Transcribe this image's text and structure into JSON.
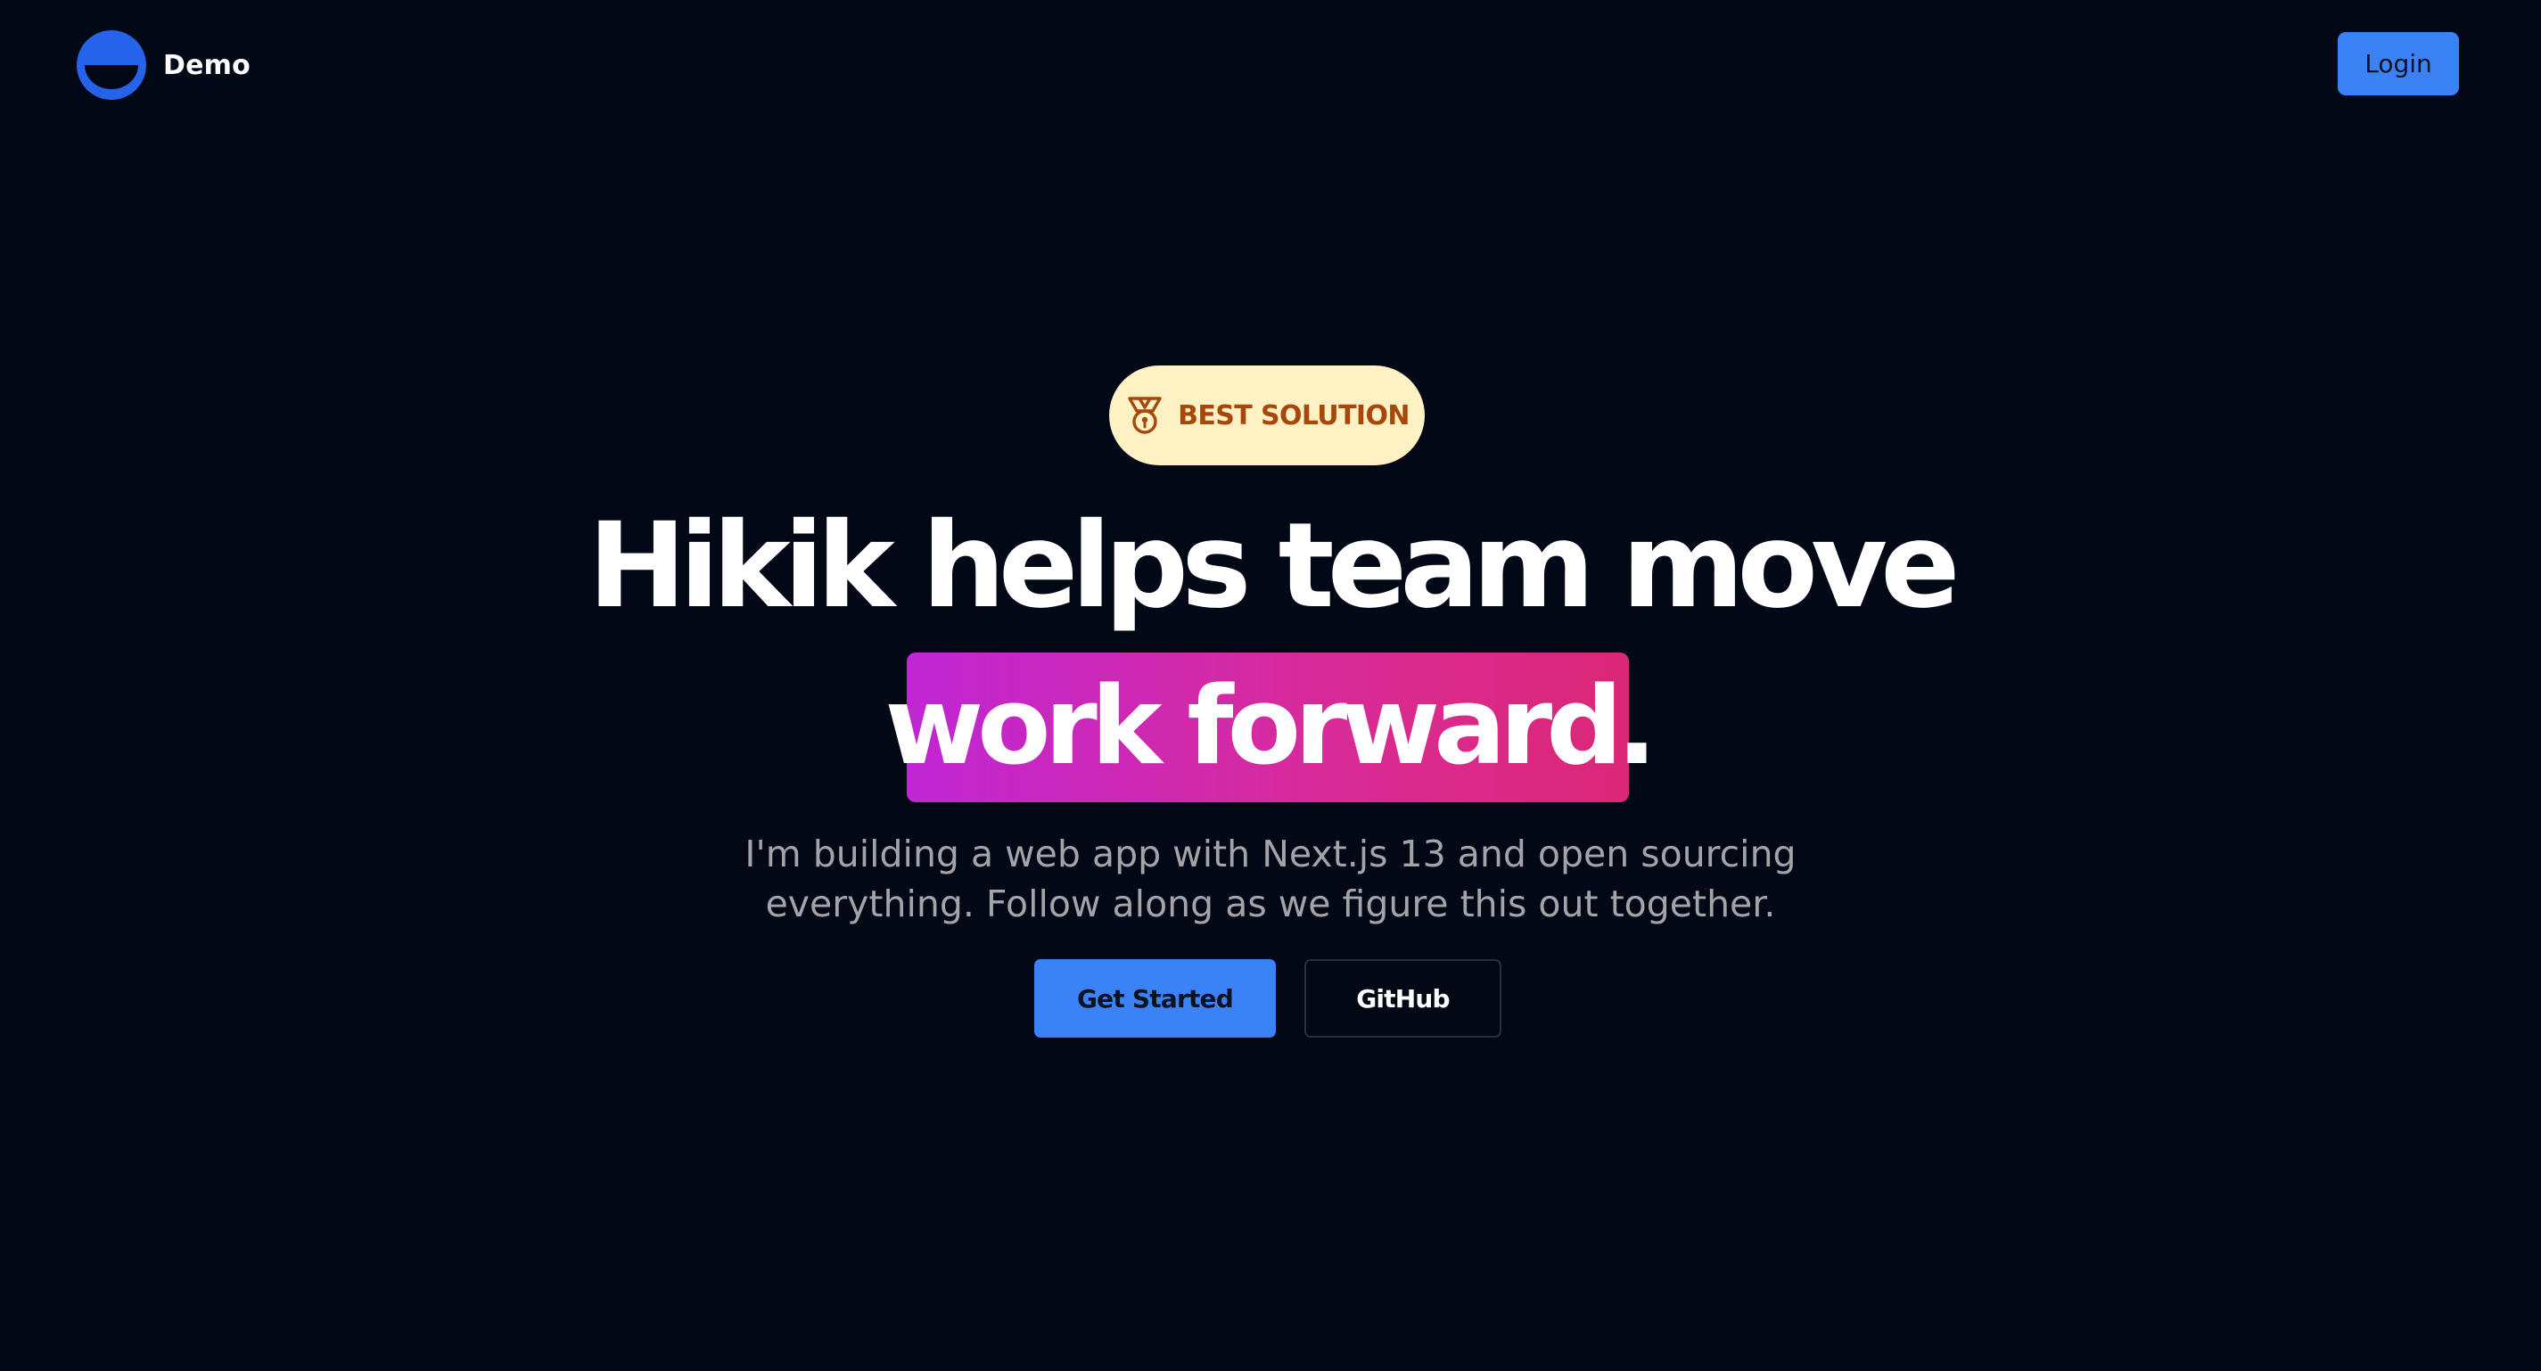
{
  "header": {
    "brand_name": "Demo",
    "logo_icon": "half-circle-logo-icon",
    "login_label": "Login"
  },
  "hero": {
    "badge_icon": "medal-icon",
    "badge_text": "BEST SOLUTION",
    "title_line_1": "Hikik helps team move",
    "title_line_2": "work forward.",
    "subtitle_line_1": "I'm building a web app with Next.js 13 and open sourcing",
    "subtitle_line_2": "everything. Follow along as we figure this out together.",
    "primary_cta": "Get Started",
    "secondary_cta": "GitHub"
  },
  "colors": {
    "background": "#030816",
    "accent_blue": "#3b82f6",
    "badge_background": "#fef1c4",
    "badge_text": "#a8470c",
    "highlight_start": "#c026d3",
    "highlight_end": "#db2777",
    "subtitle_text": "#a3a3a8"
  }
}
